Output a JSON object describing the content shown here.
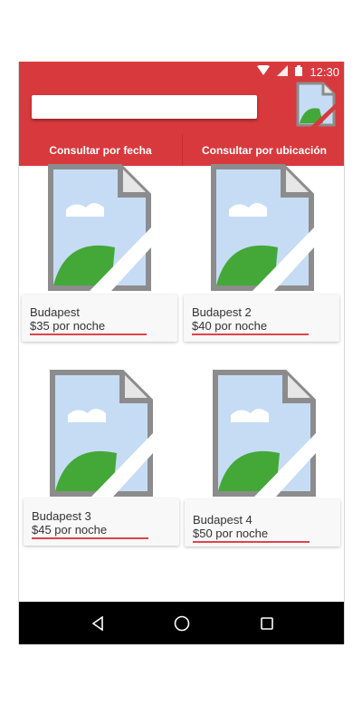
{
  "status_bar": {
    "time": "12:30",
    "icons": [
      "wifi-icon",
      "signal-icon",
      "battery-icon"
    ]
  },
  "search": {
    "value": "",
    "placeholder": ""
  },
  "header": {
    "avatar_icon": "broken-image-icon"
  },
  "tabs": [
    {
      "label": "Consultar por fecha"
    },
    {
      "label": "Consultar por ubicación"
    }
  ],
  "listings": [
    {
      "name": "Budapest",
      "price": "$35 por noche"
    },
    {
      "name": "Budapest 2",
      "price": "$40 por noche"
    },
    {
      "name": "Budapest 3",
      "price": "$45 por noche"
    },
    {
      "name": "Budapest 4",
      "price": "$50 por noche"
    }
  ],
  "nav": {
    "back_icon": "back-icon",
    "home_icon": "home-icon",
    "recents_icon": "recents-icon"
  },
  "colors": {
    "primary": "#d8393d",
    "underline": "#e0434a",
    "navbar": "#000000"
  }
}
